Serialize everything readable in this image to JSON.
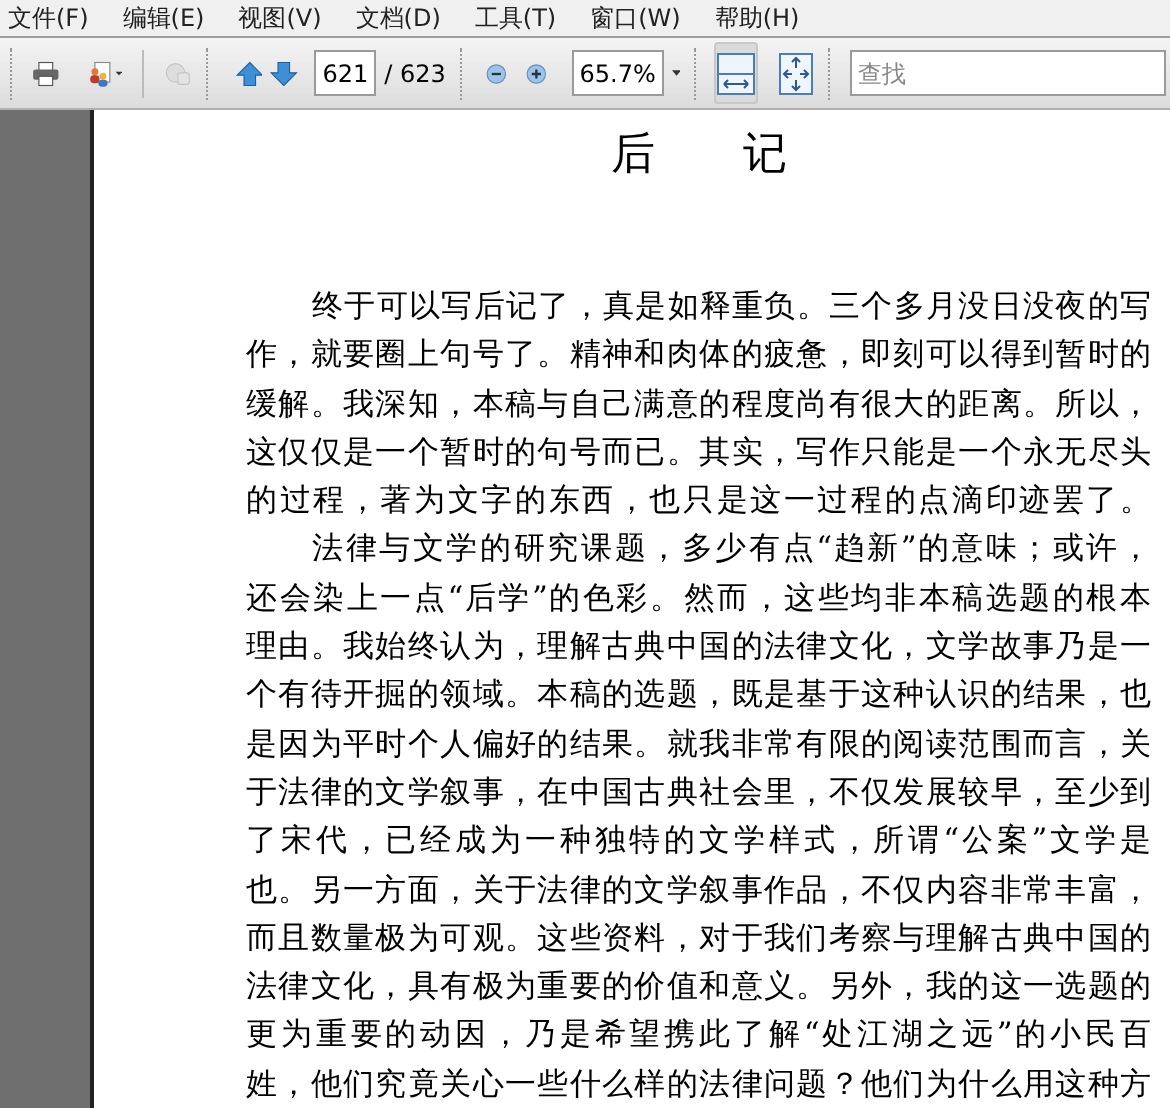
{
  "menu": [
    "文件(F)",
    "编辑(E)",
    "视图(V)",
    "文档(D)",
    "工具(T)",
    "窗口(W)",
    "帮助(H)"
  ],
  "toolbar": {
    "page_number": "621",
    "page_total": "/ 623",
    "zoom": "65.7%",
    "fit_width_selected": true,
    "fit_page_selected": false,
    "search": {
      "placeholder": "查找"
    }
  },
  "document": {
    "title": "后　　记",
    "paragraphs": [
      {
        "lines": [
          "终于可以写后记了，真是如释重负。三个多月没日没夜的写",
          "作，就要圈上句号了。精神和肉体的疲惫，即刻可以得到暂时的",
          "缓解。我深知，本稿与自己满意的程度尚有很大的距离。所以，",
          "这仅仅是一个暂时的句号而已。其实，写作只能是一个永无尽头",
          "的过程，著为文字的东西，也只是这一过程的点滴印迹罢了。"
        ]
      },
      {
        "lines": [
          "法律与文学的研究课题，多少有点“趋新”的意味；或许，",
          "还会染上一点“后学”的色彩。然而，这些均非本稿选题的根本",
          "理由。我始终认为，理解古典中国的法律文化，文学故事乃是一",
          "个有待开掘的领域。本稿的选题，既是基于这种认识的结果，也",
          "是因为平时个人偏好的结果。就我非常有限的阅读范围而言，关",
          "于法律的文学叙事，在中国古典社会里，不仅发展较早，至少到",
          "了宋代，已经成为一种独特的文学样式，所谓“公案”文学是",
          "也。另一方面，关于法律的文学叙事作品，不仅内容非常丰富，",
          "而且数量极为可观。这些资料，对于我们考察与理解古典中国的",
          "法律文化，具有极为重要的价值和意义。另外，我的这一选题的",
          "更为重要的动因，乃是希望携此了解“处江湖之远”的小民百",
          "姓，他们究竟关心一些什么样的法律问题？他们为什么用这种方"
        ]
      }
    ]
  }
}
